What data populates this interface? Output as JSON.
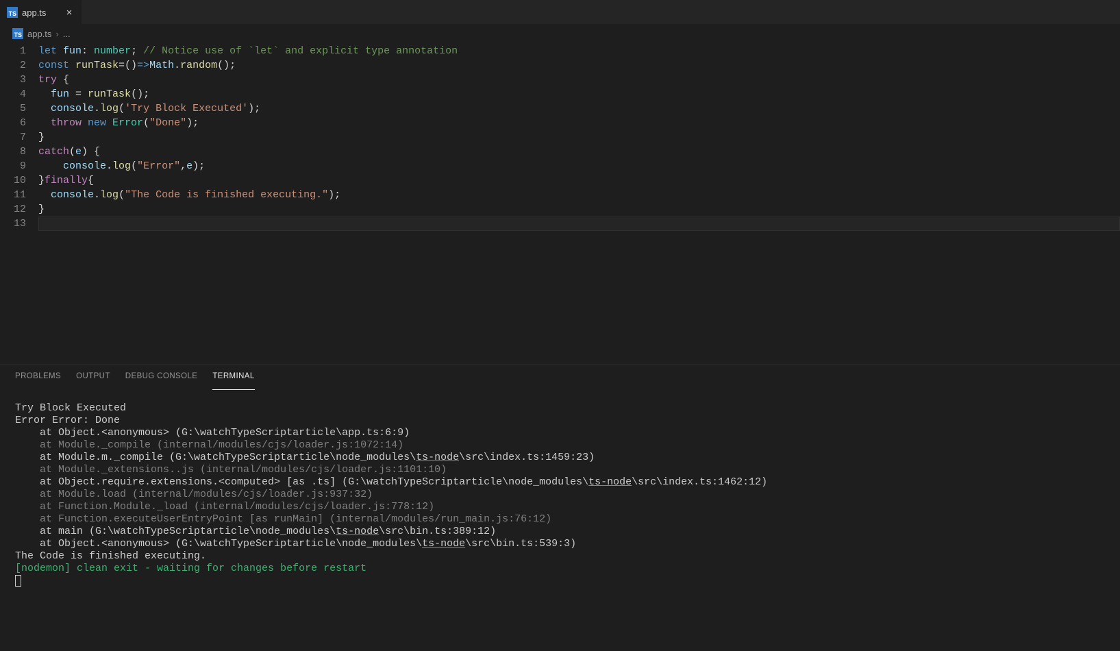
{
  "tab": {
    "filename": "app.ts",
    "icon_text": "TS"
  },
  "breadcrumb": {
    "icon_text": "TS",
    "file": "app.ts",
    "sep": "›",
    "tail": "..."
  },
  "code": {
    "lines": [
      {
        "n": 1,
        "segs": [
          {
            "t": "let ",
            "c": "kw"
          },
          {
            "t": "fun",
            "c": "var"
          },
          {
            "t": ": ",
            "c": "op"
          },
          {
            "t": "number",
            "c": "ty"
          },
          {
            "t": "; ",
            "c": "op"
          },
          {
            "t": "// Notice use of `let` and explicit type annotation",
            "c": "cmt"
          }
        ]
      },
      {
        "n": 2,
        "segs": [
          {
            "t": "const ",
            "c": "kw"
          },
          {
            "t": "runTask",
            "c": "fn"
          },
          {
            "t": "=()",
            "c": "op"
          },
          {
            "t": "=>",
            "c": "kw"
          },
          {
            "t": "Math",
            "c": "var"
          },
          {
            "t": ".",
            "c": "op"
          },
          {
            "t": "random",
            "c": "fn"
          },
          {
            "t": "();",
            "c": "op"
          }
        ]
      },
      {
        "n": 3,
        "segs": [
          {
            "t": "try ",
            "c": "kw2"
          },
          {
            "t": "{",
            "c": "pn"
          }
        ]
      },
      {
        "n": 4,
        "segs": [
          {
            "t": "  ",
            "c": "op"
          },
          {
            "t": "fun",
            "c": "var"
          },
          {
            "t": " = ",
            "c": "op"
          },
          {
            "t": "runTask",
            "c": "fn"
          },
          {
            "t": "();",
            "c": "op"
          }
        ]
      },
      {
        "n": 5,
        "segs": [
          {
            "t": "  ",
            "c": "op"
          },
          {
            "t": "console",
            "c": "var"
          },
          {
            "t": ".",
            "c": "op"
          },
          {
            "t": "log",
            "c": "fn"
          },
          {
            "t": "(",
            "c": "pn"
          },
          {
            "t": "'Try Block Executed'",
            "c": "str"
          },
          {
            "t": ");",
            "c": "op"
          }
        ]
      },
      {
        "n": 6,
        "segs": [
          {
            "t": "  ",
            "c": "op"
          },
          {
            "t": "throw ",
            "c": "kw2"
          },
          {
            "t": "new ",
            "c": "kw"
          },
          {
            "t": "Error",
            "c": "ty"
          },
          {
            "t": "(",
            "c": "pn"
          },
          {
            "t": "\"Done\"",
            "c": "str"
          },
          {
            "t": ");",
            "c": "op"
          }
        ]
      },
      {
        "n": 7,
        "segs": [
          {
            "t": "}",
            "c": "pn"
          }
        ]
      },
      {
        "n": 8,
        "segs": [
          {
            "t": "catch",
            "c": "kw2"
          },
          {
            "t": "(",
            "c": "pn"
          },
          {
            "t": "e",
            "c": "var"
          },
          {
            "t": ") {",
            "c": "pn"
          }
        ]
      },
      {
        "n": 9,
        "segs": [
          {
            "t": "    ",
            "c": "op"
          },
          {
            "t": "console",
            "c": "var"
          },
          {
            "t": ".",
            "c": "op"
          },
          {
            "t": "log",
            "c": "fn"
          },
          {
            "t": "(",
            "c": "pn"
          },
          {
            "t": "\"Error\"",
            "c": "str"
          },
          {
            "t": ",",
            "c": "op"
          },
          {
            "t": "e",
            "c": "var"
          },
          {
            "t": ");",
            "c": "op"
          }
        ]
      },
      {
        "n": 10,
        "segs": [
          {
            "t": "}",
            "c": "pn"
          },
          {
            "t": "finally",
            "c": "kw2"
          },
          {
            "t": "{",
            "c": "pn"
          }
        ]
      },
      {
        "n": 11,
        "segs": [
          {
            "t": "  ",
            "c": "op"
          },
          {
            "t": "console",
            "c": "var"
          },
          {
            "t": ".",
            "c": "op"
          },
          {
            "t": "log",
            "c": "fn"
          },
          {
            "t": "(",
            "c": "pn"
          },
          {
            "t": "\"The Code is finished executing.\"",
            "c": "str"
          },
          {
            "t": ");",
            "c": "op"
          }
        ]
      },
      {
        "n": 12,
        "segs": [
          {
            "t": "}",
            "c": "pn"
          }
        ]
      },
      {
        "n": 13,
        "segs": [],
        "current": true
      }
    ]
  },
  "panel": {
    "tabs": {
      "problems": "PROBLEMS",
      "output": "OUTPUT",
      "debug": "DEBUG CONSOLE",
      "terminal": "TERMINAL"
    }
  },
  "terminal": {
    "lines": [
      {
        "segs": [
          {
            "t": "Try Block Executed",
            "c": "bright"
          }
        ]
      },
      {
        "segs": [
          {
            "t": "Error Error: Done",
            "c": "bright"
          }
        ]
      },
      {
        "segs": [
          {
            "t": "    at Object.<anonymous> (G:\\watchTypeScriptarticle\\app.ts:6:9)",
            "c": "bright"
          }
        ]
      },
      {
        "segs": [
          {
            "t": "    at Module._compile (internal/modules/cjs/loader.js:1072:14)",
            "c": "dim"
          }
        ]
      },
      {
        "segs": [
          {
            "t": "    at Module.m._compile (G:\\watchTypeScriptarticle\\node_modules\\",
            "c": "bright"
          },
          {
            "t": "ts-node",
            "c": "bright underlinelink"
          },
          {
            "t": "\\src\\index.ts:1459:23)",
            "c": "bright"
          }
        ]
      },
      {
        "segs": [
          {
            "t": "    at Module._extensions..js (internal/modules/cjs/loader.js:1101:10)",
            "c": "dim"
          }
        ]
      },
      {
        "segs": [
          {
            "t": "    at Object.require.extensions.<computed> [as .ts] (G:\\watchTypeScriptarticle\\node_modules\\",
            "c": "bright"
          },
          {
            "t": "ts-node",
            "c": "bright underlinelink"
          },
          {
            "t": "\\src\\index.ts:1462:12)",
            "c": "bright"
          }
        ]
      },
      {
        "segs": [
          {
            "t": "    at Module.load (internal/modules/cjs/loader.js:937:32)",
            "c": "dim"
          }
        ]
      },
      {
        "segs": [
          {
            "t": "    at Function.Module._load (internal/modules/cjs/loader.js:778:12)",
            "c": "dim"
          }
        ]
      },
      {
        "segs": [
          {
            "t": "    at Function.executeUserEntryPoint [as runMain] (internal/modules/run_main.js:76:12)",
            "c": "dim"
          }
        ]
      },
      {
        "segs": [
          {
            "t": "    at main (G:\\watchTypeScriptarticle\\node_modules\\",
            "c": "bright"
          },
          {
            "t": "ts-node",
            "c": "bright underlinelink"
          },
          {
            "t": "\\src\\bin.ts:389:12)",
            "c": "bright"
          }
        ]
      },
      {
        "segs": [
          {
            "t": "    at Object.<anonymous> (G:\\watchTypeScriptarticle\\node_modules\\",
            "c": "bright"
          },
          {
            "t": "ts-node",
            "c": "bright underlinelink"
          },
          {
            "t": "\\src\\bin.ts:539:3)",
            "c": "bright"
          }
        ]
      },
      {
        "segs": [
          {
            "t": "The Code is finished executing.",
            "c": "bright"
          }
        ]
      },
      {
        "segs": [
          {
            "t": "[nodemon] clean exit - waiting for changes before restart",
            "c": "green"
          }
        ]
      }
    ]
  }
}
